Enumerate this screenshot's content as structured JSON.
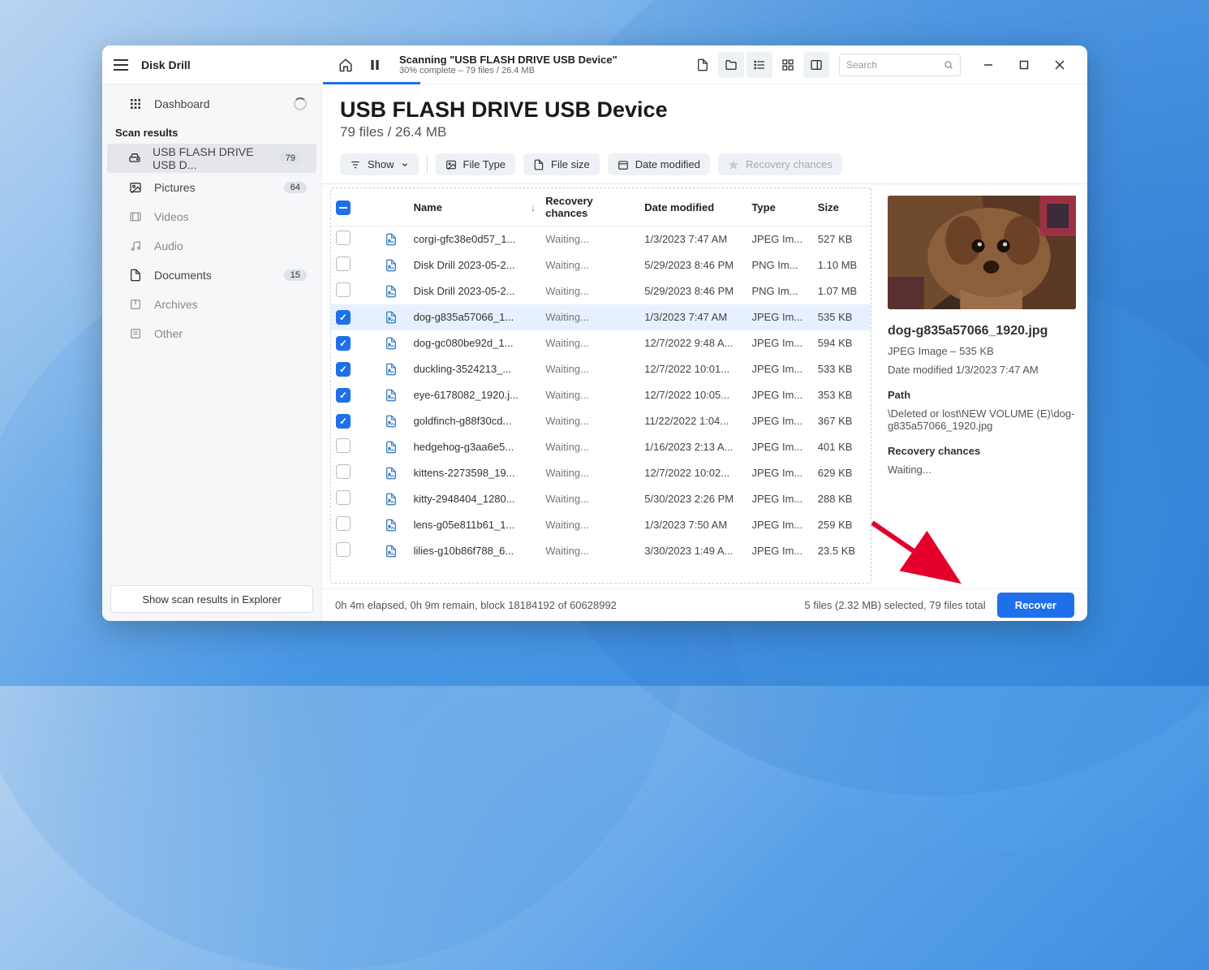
{
  "titlebar": {
    "app_name": "Disk Drill",
    "scan_title": "Scanning \"USB FLASH DRIVE USB Device\"",
    "scan_sub": "30% complete – 79 files / 26.4 MB",
    "search_placeholder": "Search"
  },
  "sidebar": {
    "dashboard": "Dashboard",
    "section_label": "Scan results",
    "items": [
      {
        "label": "USB FLASH DRIVE USB D...",
        "badge": "79",
        "selected": true,
        "icon": "drive"
      },
      {
        "label": "Pictures",
        "badge": "64",
        "icon": "image"
      },
      {
        "label": "Videos",
        "muted": true,
        "icon": "video"
      },
      {
        "label": "Audio",
        "muted": true,
        "icon": "audio"
      },
      {
        "label": "Documents",
        "badge": "15",
        "icon": "doc"
      },
      {
        "label": "Archives",
        "muted": true,
        "icon": "archive"
      },
      {
        "label": "Other",
        "muted": true,
        "icon": "other"
      }
    ],
    "explorer_btn": "Show scan results in Explorer"
  },
  "header": {
    "title": "USB FLASH DRIVE USB Device",
    "sub": "79 files / 26.4 MB"
  },
  "filters": {
    "show": "Show",
    "file_type": "File Type",
    "file_size": "File size",
    "date_modified": "Date modified",
    "recovery": "Recovery chances"
  },
  "table": {
    "headers": {
      "name": "Name",
      "recovery": "Recovery chances",
      "date": "Date modified",
      "type": "Type",
      "size": "Size"
    },
    "rows": [
      {
        "sel": false,
        "name": "corgi-gfc38e0d57_1...",
        "rec": "Waiting...",
        "date": "1/3/2023 7:47 AM",
        "type": "JPEG Im...",
        "size": "527 KB"
      },
      {
        "sel": false,
        "name": "Disk Drill 2023-05-2...",
        "rec": "Waiting...",
        "date": "5/29/2023 8:46 PM",
        "type": "PNG Im...",
        "size": "1.10 MB"
      },
      {
        "sel": false,
        "name": "Disk Drill 2023-05-2...",
        "rec": "Waiting...",
        "date": "5/29/2023 8:46 PM",
        "type": "PNG Im...",
        "size": "1.07 MB"
      },
      {
        "sel": true,
        "name": "dog-g835a57066_1...",
        "rec": "Waiting...",
        "date": "1/3/2023 7:47 AM",
        "type": "JPEG Im...",
        "size": "535 KB",
        "hl": true
      },
      {
        "sel": true,
        "name": "dog-gc080be92d_1...",
        "rec": "Waiting...",
        "date": "12/7/2022 9:48 A...",
        "type": "JPEG Im...",
        "size": "594 KB"
      },
      {
        "sel": true,
        "name": "duckling-3524213_...",
        "rec": "Waiting...",
        "date": "12/7/2022 10:01...",
        "type": "JPEG Im...",
        "size": "533 KB"
      },
      {
        "sel": true,
        "name": "eye-6178082_1920.j...",
        "rec": "Waiting...",
        "date": "12/7/2022 10:05...",
        "type": "JPEG Im...",
        "size": "353 KB"
      },
      {
        "sel": true,
        "name": "goldfinch-g88f30cd...",
        "rec": "Waiting...",
        "date": "11/22/2022 1:04...",
        "type": "JPEG Im...",
        "size": "367 KB"
      },
      {
        "sel": false,
        "name": "hedgehog-g3aa6e5...",
        "rec": "Waiting...",
        "date": "1/16/2023 2:13 A...",
        "type": "JPEG Im...",
        "size": "401 KB"
      },
      {
        "sel": false,
        "name": "kittens-2273598_19...",
        "rec": "Waiting...",
        "date": "12/7/2022 10:02...",
        "type": "JPEG Im...",
        "size": "629 KB"
      },
      {
        "sel": false,
        "name": "kitty-2948404_1280...",
        "rec": "Waiting...",
        "date": "5/30/2023 2:26 PM",
        "type": "JPEG Im...",
        "size": "288 KB"
      },
      {
        "sel": false,
        "name": "lens-g05e811b61_1...",
        "rec": "Waiting...",
        "date": "1/3/2023 7:50 AM",
        "type": "JPEG Im...",
        "size": "259 KB"
      },
      {
        "sel": false,
        "name": "lilies-g10b86f788_6...",
        "rec": "Waiting...",
        "date": "3/30/2023 1:49 A...",
        "type": "JPEG Im...",
        "size": "23.5 KB"
      }
    ]
  },
  "preview": {
    "filename": "dog-g835a57066_1920.jpg",
    "meta1": "JPEG Image – 535 KB",
    "meta2": "Date modified 1/3/2023 7:47 AM",
    "path_label": "Path",
    "path": "\\Deleted or lost\\NEW VOLUME (E)\\dog-g835a57066_1920.jpg",
    "rec_label": "Recovery chances",
    "rec_value": "Waiting..."
  },
  "footer": {
    "status": "0h 4m elapsed, 0h 9m remain, block 18184192 of 60628992",
    "selection": "5 files (2.32 MB) selected, 79 files total",
    "recover": "Recover"
  }
}
